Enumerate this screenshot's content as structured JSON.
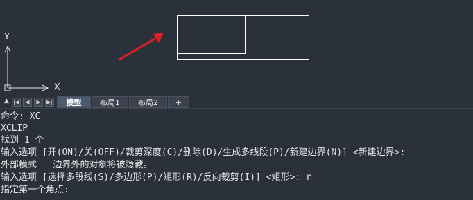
{
  "canvas": {
    "axis_y_label": "Y",
    "axis_x_label": "X"
  },
  "tabs": {
    "model": "模型",
    "layout1": "布局1",
    "layout2": "布局2",
    "add": "+",
    "active": "模型"
  },
  "nav_icons": [
    "scroll-up-icon",
    "first-tab-icon",
    "prev-tab-icon",
    "next-tab-icon",
    "last-tab-icon"
  ],
  "command_history": [
    "命令: XC",
    "XCLIP",
    "找到 1 个",
    "输入选项 [开(ON)/关(OFF)/裁剪深度(C)/删除(D)/生成多线段(P)/新建边界(N)] <新建边界>:",
    "外部模式 - 边界外的对象将被隐藏。",
    "输入选项 [选择多段线(S)/多边形(P)/矩形(R)/反向裁剪(I)] <矩形>: r",
    "指定第一个角点:"
  ],
  "colors": {
    "background": "#2b313b",
    "geometry": "#ffffff",
    "arrow": "#e02020",
    "active_tab": "#4d5b70"
  }
}
